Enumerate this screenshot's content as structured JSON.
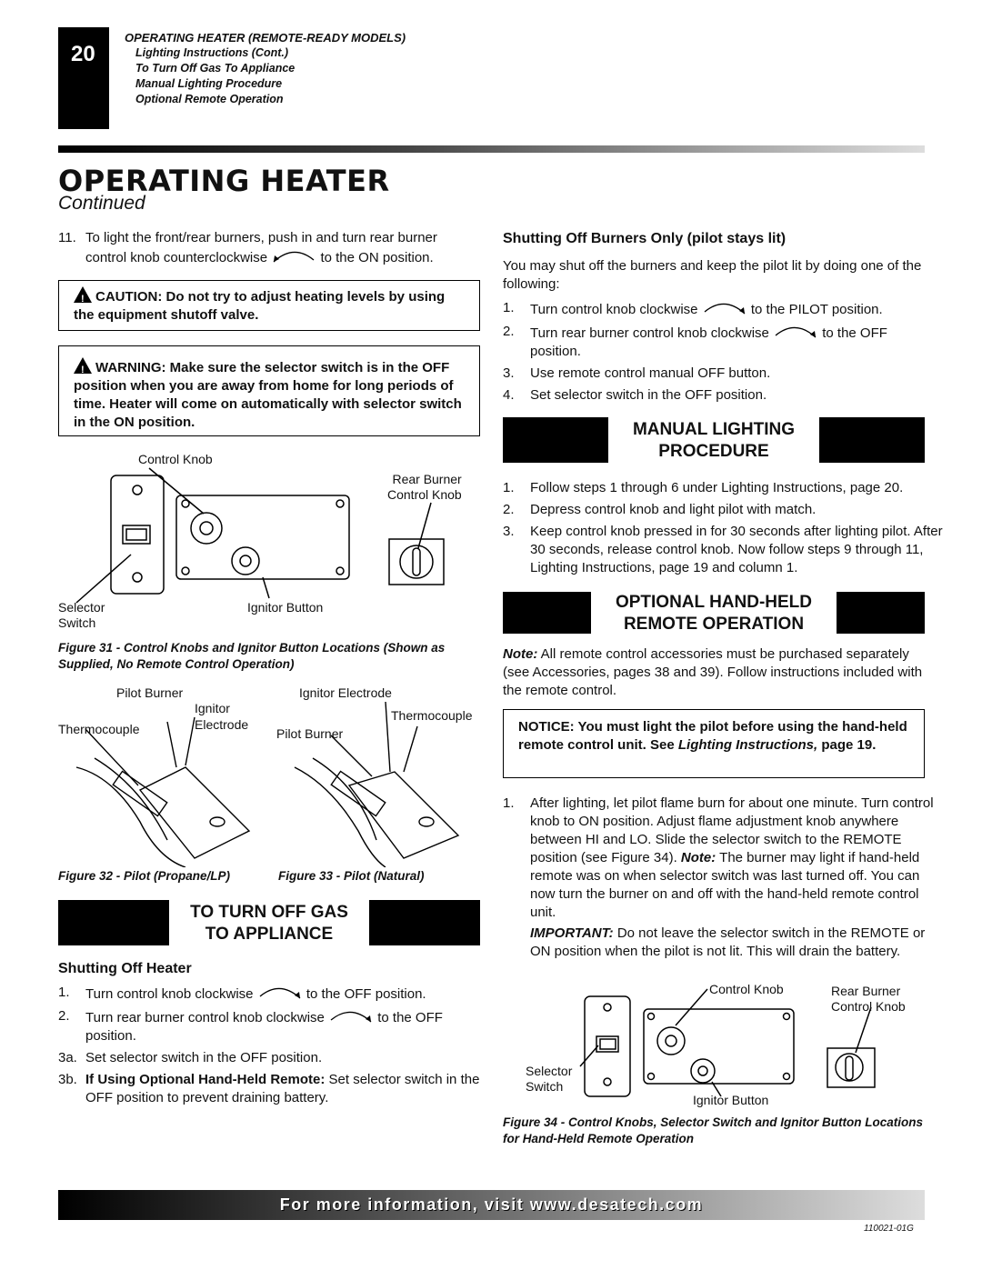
{
  "header": {
    "page_number": "20",
    "section": "OPERATING HEATER (REMOTE-READY MODELS)",
    "topics": [
      "Lighting Instructions (Cont.)",
      "To Turn Off Gas To Appliance",
      "Manual Lighting Procedure",
      "Optional Remote Operation"
    ]
  },
  "title": "OPERATING HEATER",
  "subtitle": "Continued",
  "left": {
    "step11_num": "11.",
    "step11_a": "To light the front/rear burners, push in and turn rear burner control knob counterclockwise",
    "step11_b": "to the ON position.",
    "caution": "CAUTION: Do not try to adjust heating levels by using the equipment shutoff valve.",
    "warning": "WARNING: Make sure the selector switch is in the OFF position when you are away from home for long periods of time. Heater will come on automatically with selector switch in the ON position.",
    "fig31": {
      "control_knob": "Control Knob",
      "rear_burner": "Rear Burner",
      "rear_knob": "Control Knob",
      "selector": "Selector",
      "switch": "Switch",
      "ignitor_button": "Ignitor Button",
      "caption": "Figure 31 - Control Knobs and Ignitor Button Locations (Shown as Supplied, No Remote Control Operation)"
    },
    "fig32": {
      "pilot_burner": "Pilot Burner",
      "ignitor": "Ignitor",
      "electrode": "Electrode",
      "thermocouple": "Thermocouple",
      "caption": "Figure 32 - Pilot (Propane/LP)"
    },
    "fig33": {
      "ignitor_electrode": "Ignitor Electrode",
      "thermocouple": "Thermocouple",
      "pilot_burner": "Pilot Burner",
      "caption": "Figure 33 - Pilot (Natural)"
    },
    "turn_off_heading_1": "TO TURN OFF GAS",
    "turn_off_heading_2": "TO APPLIANCE",
    "shutting_off_heater": "Shutting Off Heater",
    "steps": [
      {
        "n": "1.",
        "a": "Turn control knob clockwise",
        "b": "to the OFF position."
      },
      {
        "n": "2.",
        "a": "Turn rear burner control knob clockwise",
        "b": "to the OFF position."
      },
      {
        "n": "3a.",
        "a": "Set selector switch in the OFF position."
      },
      {
        "n": "3b.",
        "bold": "If Using Optional Hand-Held Remote:",
        "a": "Set selector switch in the OFF position to prevent draining battery."
      }
    ]
  },
  "right": {
    "burners_heading": "Shutting Off Burners Only (pilot stays lit)",
    "burners_intro": "You may shut off the burners and keep the pilot lit by doing one of the following:",
    "burners_steps": [
      {
        "n": "1.",
        "a": "Turn control knob clockwise",
        "b": "to the PILOT position."
      },
      {
        "n": "2.",
        "a": "Turn rear burner control knob clockwise",
        "b": "to the OFF position."
      },
      {
        "n": "3.",
        "a": "Use remote control manual OFF button."
      },
      {
        "n": "4.",
        "a": "Set selector switch in the OFF position."
      }
    ],
    "manual_heading_1": "MANUAL LIGHTING",
    "manual_heading_2": "PROCEDURE",
    "manual_steps": [
      {
        "n": "1.",
        "a": "Follow steps 1 through 6 under Lighting Instructions, page 20."
      },
      {
        "n": "2.",
        "a": "Depress control knob and light pilot with match."
      },
      {
        "n": "3.",
        "a": "Keep control knob pressed in for 30 seconds after lighting pilot. After 30 seconds, release control knob. Now follow steps 9 through 11, Lighting Instructions, page 19 and column 1."
      }
    ],
    "remote_heading_1": "OPTIONAL HAND-HELD",
    "remote_heading_2": "REMOTE OPERATION",
    "note_label": "Note:",
    "note": "All remote control accessories must be purchased separately (see Accessories, pages 38 and 39). Follow instructions included with the remote control.",
    "notice_a": "NOTICE: You must light the pilot before using the hand-held remote control unit. See",
    "notice_link": "Lighting Instructions,",
    "notice_b": "page 19.",
    "after_n": "1.",
    "after": "After lighting, let pilot flame burn for about one minute. Turn control knob to ON position. Adjust flame adjustment knob anywhere between HI and LO. Slide the selector switch to the REMOTE position (see Figure 34).",
    "after_note_label": "Note:",
    "after_note": "The burner may light if hand-held remote was on when selector switch was last turned off. You can now turn the burner on and off with the hand-held remote control unit.",
    "important_label": "IMPORTANT:",
    "important": "Do not leave the selector switch in the REMOTE or ON position when the pilot is not lit. This will drain the battery.",
    "fig34": {
      "control_knob": "Control Knob",
      "rear_burner": "Rear Burner",
      "rear_knob": "Control Knob",
      "selector": "Selector",
      "switch": "Switch",
      "ignitor_button": "Ignitor Button",
      "caption": "Figure 34 - Control Knobs, Selector Switch and Ignitor Button Locations for Hand-Held Remote Operation"
    }
  },
  "footer": {
    "banner": "For more information, visit www.desatech.com",
    "doc_id": "110021-01G"
  }
}
